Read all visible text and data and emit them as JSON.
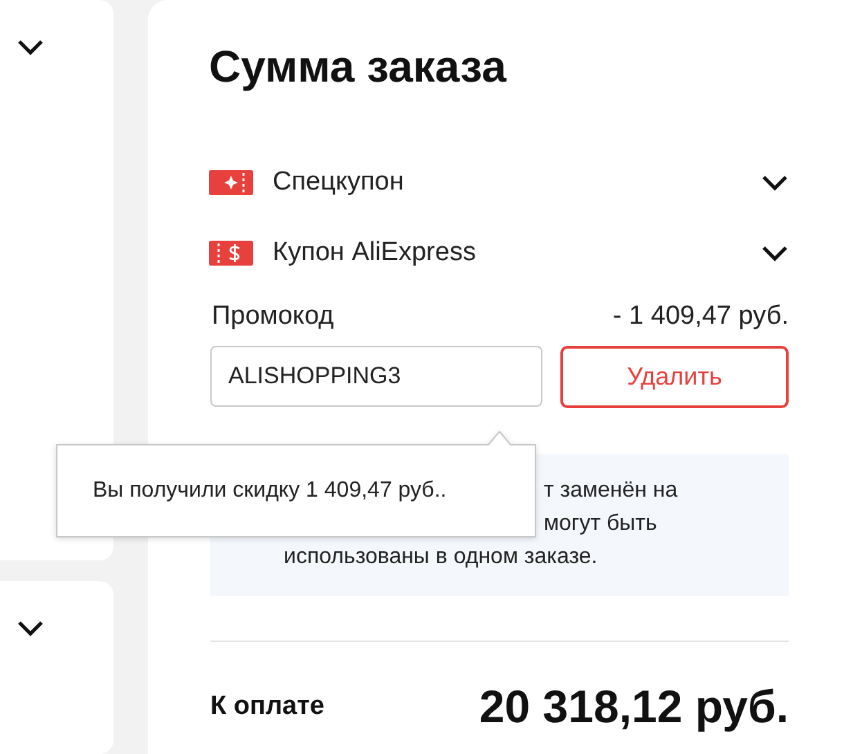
{
  "side_cards": [
    {
      "expanded": false
    },
    {
      "expanded": false
    }
  ],
  "summary": {
    "title": "Сумма заказа",
    "coupons": [
      {
        "kind": "special",
        "label": "Спецкупон",
        "expanded": false
      },
      {
        "kind": "store",
        "label": "Купон AliExpress",
        "expanded": false
      }
    ],
    "promo": {
      "label": "Промокод",
      "discount": "- 1 409,47 руб.",
      "value": "ALISHOPPING3",
      "button": "Удалить"
    },
    "info_lines": [
      "т заменён на",
      "могут быть",
      "использованы в одном заказе."
    ],
    "total": {
      "label": "К оплате",
      "amount": "20 318,12 руб."
    }
  },
  "tooltip": {
    "text": "Вы получили скидку 1 409,47 руб.."
  }
}
